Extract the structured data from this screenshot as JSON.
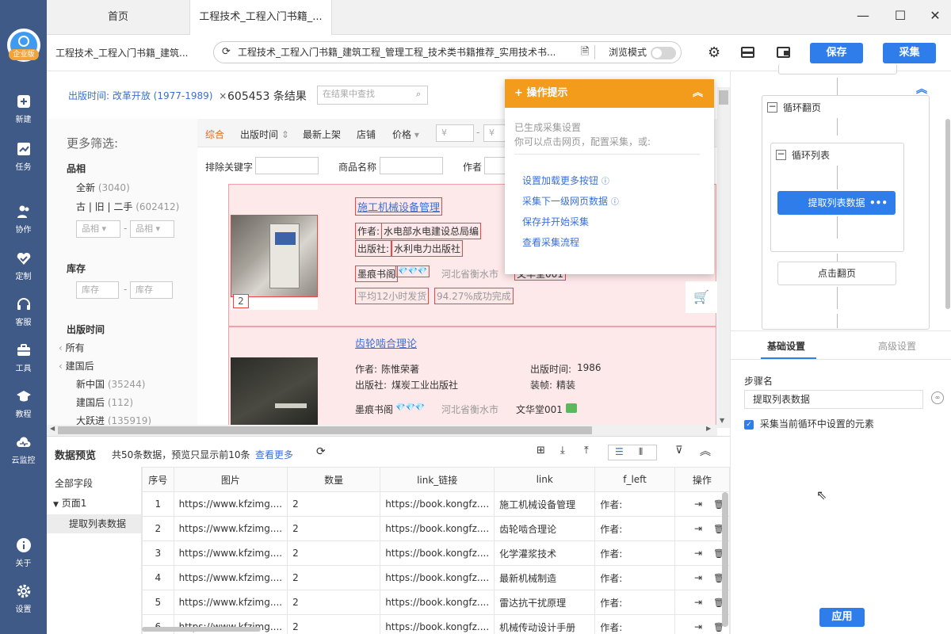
{
  "sidebar": {
    "logo_badge": "企业版",
    "items": [
      {
        "label": "新建",
        "icon": "plus-square-icon"
      },
      {
        "label": "任务",
        "icon": "chart-icon"
      },
      {
        "label": "协作",
        "icon": "users-icon"
      },
      {
        "label": "定制",
        "icon": "heart-check-icon"
      },
      {
        "label": "客服",
        "icon": "headset-icon"
      },
      {
        "label": "工具",
        "icon": "toolbox-icon"
      },
      {
        "label": "教程",
        "icon": "graduation-cap-icon"
      },
      {
        "label": "云监控",
        "icon": "cloud-monitor-icon"
      },
      {
        "label": "关于",
        "icon": "info-icon"
      },
      {
        "label": "设置",
        "icon": "gear-icon"
      }
    ]
  },
  "tabs": {
    "home": "首页",
    "active": "工程技术_工程入门书籍_..."
  },
  "address": {
    "page_title": "工程技术_工程入门书籍_建筑...",
    "url": "工程技术_工程入门书籍_建筑工程_管理工程_技术类书籍推荐_实用技术书...",
    "browse_mode": "浏览模式",
    "save": "保存",
    "collect": "采集"
  },
  "webpage": {
    "filter_tag": "出版时间: 改革开放 (1977-1989)",
    "result_count": "605453 条结果",
    "search_placeholder": "在结果中查找",
    "more_filters": "更多筛选:",
    "condition_title": "品相",
    "condition_new": "全新",
    "condition_new_count": "(3040)",
    "condition_used": "古 | 旧 | 二手",
    "condition_used_count": "(602412)",
    "condition_sel1": "品相",
    "condition_sel2": "品相",
    "stock_title": "库存",
    "stock_ph1": "库存",
    "stock_ph2": "库存",
    "pubtime_title": "出版时间",
    "pub_all": "所有",
    "pub_after": "建国后",
    "pub_new_china": "新中国",
    "pub_new_china_count": "(35244)",
    "pub_jg": "建国后",
    "pub_jg_count": "(112)",
    "pub_dyj": "大跃进",
    "pub_dyj_count": "(135919)",
    "sort": [
      "综合",
      "出版时间",
      "最新上架",
      "店铺",
      "价格"
    ],
    "price_ph1": "¥",
    "price_ph2": "¥",
    "exclude_kw": "排除关键字",
    "product_name": "商品名称",
    "author_lbl": "作者",
    "book1": {
      "title": "施工机械设备管理",
      "author_lbl": "作者:",
      "author": "水电部水电建设总局编",
      "pub_lbl": "出版社:",
      "pub": "水利电力出版社",
      "shop": "墨痕书阁",
      "diamonds": "💎💎💎",
      "location": "河北省衡水市",
      "shop2": "文华堂001",
      "ship": "平均12小时发货",
      "success": "94.27%成功完成",
      "img_count": "2"
    },
    "book2": {
      "title": "齿轮啮合理论",
      "author_lbl": "作者:",
      "author": "陈惟荣著",
      "pubtime_lbl": "出版时间:",
      "pubtime": "1986",
      "pub_lbl": "出版社:",
      "pub": "煤炭工业出版社",
      "binding_lbl": "装帧:",
      "binding": "精装",
      "shop": "墨痕书阁",
      "diamonds": "💎💎💎",
      "location": "河北省衡水市",
      "shop2": "文华堂001"
    }
  },
  "tip": {
    "title": "操作提示",
    "line1": "已生成采集设置",
    "line2": "你可以点击网页，配置采集，或:",
    "links": [
      "设置加载更多按钮",
      "采集下一级网页数据",
      "保存并开始采集",
      "查看采集流程"
    ]
  },
  "flow": {
    "loop_page": "循环翻页",
    "loop_list": "循环列表",
    "extract": "提取列表数据",
    "click_next": "点击翻页"
  },
  "settings": {
    "tab_basic": "基础设置",
    "tab_adv": "高级设置",
    "step_name_lbl": "步骤名",
    "step_name": "提取列表数据",
    "checkbox_label": "采集当前循环中设置的元素",
    "apply": "应用"
  },
  "preview": {
    "title": "数据预览",
    "summary": "共50条数据，预览只显示前10条",
    "view_more": "查看更多",
    "all_fields": "全部字段",
    "page1": "页面1",
    "extract_item": "提取列表数据",
    "columns": [
      "序号",
      "图片",
      "数量",
      "link_链接",
      "link",
      "f_left",
      "操作"
    ],
    "rows": [
      [
        "1",
        "https://www.kfzimg....",
        "2",
        "https://book.kongfz....",
        "施工机械设备管理",
        "作者:"
      ],
      [
        "2",
        "https://www.kfzimg....",
        "2",
        "https://book.kongfz....",
        "齿轮啮合理论",
        "作者:"
      ],
      [
        "3",
        "https://www.kfzimg....",
        "2",
        "https://book.kongfz....",
        "化学灌浆技术",
        "作者:"
      ],
      [
        "4",
        "https://www.kfzimg....",
        "2",
        "https://book.kongfz....",
        "最新机械制造",
        "作者:"
      ],
      [
        "5",
        "https://www.kfzimg....",
        "2",
        "https://book.kongfz....",
        "雷达抗干扰原理",
        "作者:"
      ],
      [
        "6",
        "https://www.kfzimg....",
        "2",
        "https://book.kongfz....",
        "机械传动设计手册",
        "作者:"
      ]
    ]
  }
}
